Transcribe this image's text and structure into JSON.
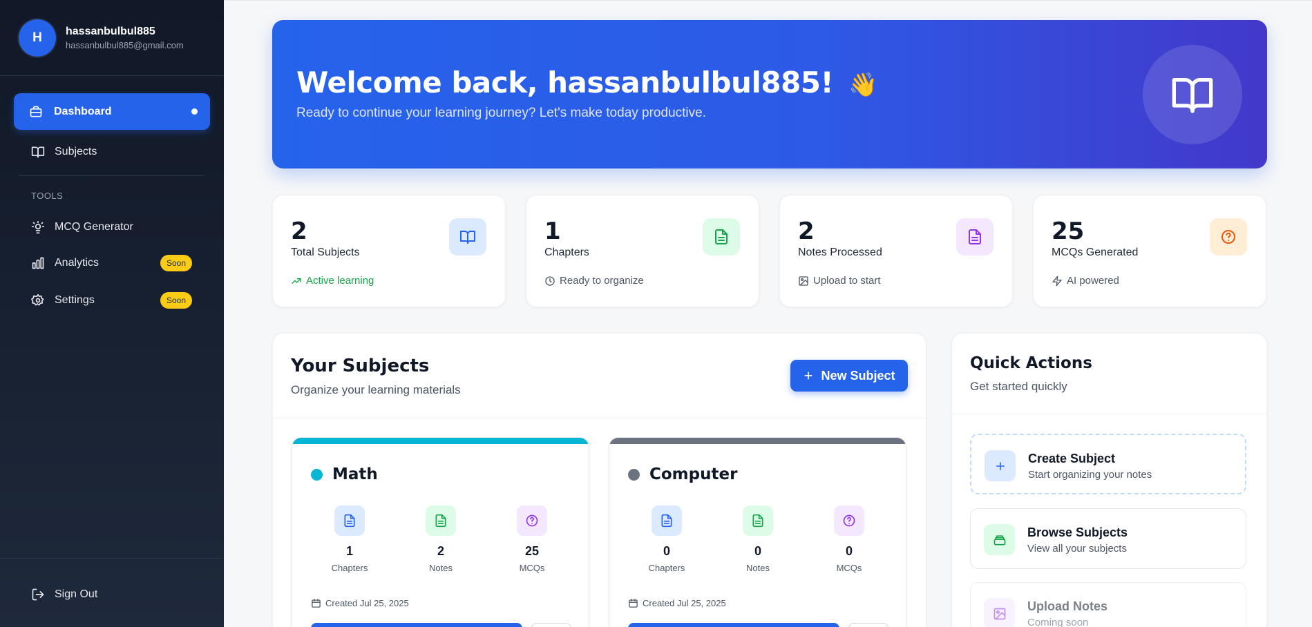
{
  "user": {
    "initial": "H",
    "name": "hassanbulbul885",
    "email": "hassanbulbul885@gmail.com"
  },
  "nav": {
    "dashboard": "Dashboard",
    "subjects": "Subjects",
    "tools_header": "TOOLS",
    "mcq_generator": "MCQ Generator",
    "analytics": "Analytics",
    "settings": "Settings",
    "soon_badge": "Soon",
    "sign_out": "Sign Out"
  },
  "hero": {
    "title": "Welcome back, hassanbulbul885!",
    "emoji": "👋",
    "subtitle": "Ready to continue your learning journey? Let's make today productive."
  },
  "stats": [
    {
      "value": "2",
      "label": "Total Subjects",
      "sub": "Active learning",
      "icon": "book-icon"
    },
    {
      "value": "1",
      "label": "Chapters",
      "sub": "Ready to organize",
      "icon": "file-text-icon"
    },
    {
      "value": "2",
      "label": "Notes Processed",
      "sub": "Upload to start",
      "icon": "file-icon"
    },
    {
      "value": "25",
      "label": "MCQs Generated",
      "sub": "AI powered",
      "icon": "help-circle-icon"
    }
  ],
  "subjects_panel": {
    "title": "Your Subjects",
    "description": "Organize your learning materials",
    "new_button": "New Subject",
    "items": [
      {
        "name": "Math",
        "color": "#06b6d4",
        "chapters": "1",
        "notes": "2",
        "mcqs": "25",
        "created": "Created Jul 25, 2025"
      },
      {
        "name": "Computer",
        "color": "#6b7280",
        "chapters": "0",
        "notes": "0",
        "mcqs": "0",
        "created": "Created Jul 25, 2025"
      }
    ],
    "labels": {
      "chapters": "Chapters",
      "notes": "Notes",
      "mcqs": "MCQs"
    }
  },
  "quick_actions": {
    "title": "Quick Actions",
    "description": "Get started quickly",
    "items": [
      {
        "title": "Create Subject",
        "subtitle": "Start organizing your notes"
      },
      {
        "title": "Browse Subjects",
        "subtitle": "View all your subjects"
      },
      {
        "title": "Upload Notes",
        "subtitle": "Coming soon"
      }
    ]
  },
  "colors": {
    "primary": "#2563eb",
    "sidebar": "#111827",
    "soon": "#facc15",
    "success": "#16a34a"
  }
}
